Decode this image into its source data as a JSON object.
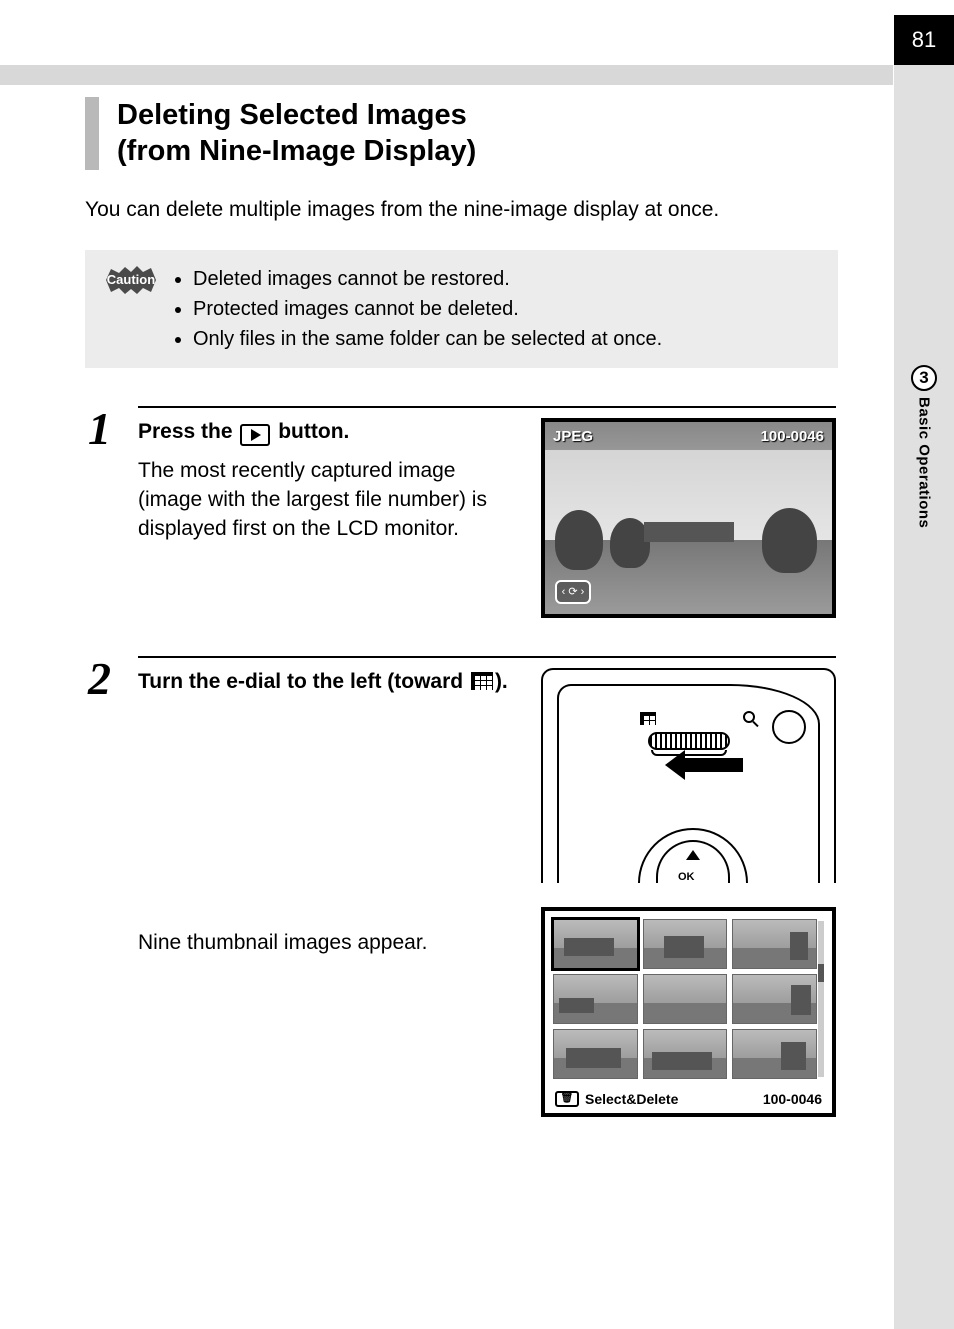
{
  "page": {
    "number": "81",
    "chapter_number": "3",
    "chapter_title": "Basic Operations"
  },
  "heading": {
    "line1": "Deleting Selected Images",
    "line2": "(from Nine-Image Display)"
  },
  "intro": "You can delete multiple images from the nine-image display at once.",
  "caution": {
    "label": "Caution",
    "items": [
      "Deleted images cannot be restored.",
      "Protected images cannot be deleted.",
      "Only files in the same folder can be selected at once."
    ]
  },
  "steps": {
    "one": {
      "num": "1",
      "headline_pre": "Press the ",
      "headline_post": " button.",
      "desc": "The most recently captured image (image with the largest file number) is displayed first on the LCD monitor.",
      "lcd": {
        "format": "JPEG",
        "file": "100-0046"
      }
    },
    "two": {
      "num": "2",
      "headline_pre": "Turn the e-dial to the left (toward ",
      "headline_post": ").",
      "sub": "Nine thumbnail images appear.",
      "nine_lcd": {
        "action": "Select&Delete",
        "file": "100-0046"
      }
    }
  }
}
